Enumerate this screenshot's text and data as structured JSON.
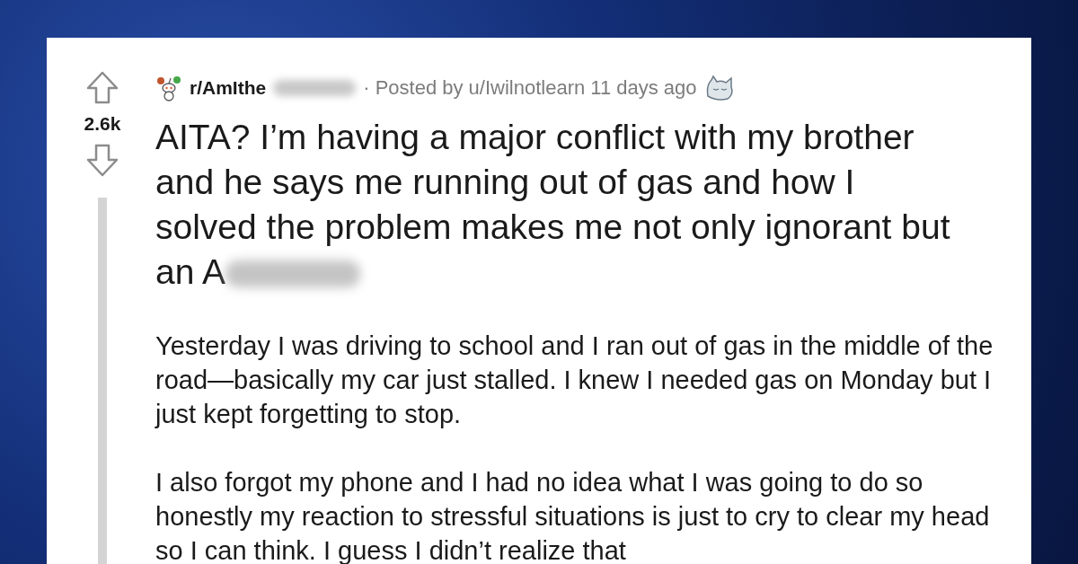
{
  "post": {
    "subreddit": "r/AmIthe",
    "posted_by": "· Posted by u/Iwilnotlearn 11 days ago",
    "votes": "2.6k",
    "title": "AITA? I’m having a major conflict with my brother and he says me running out of gas and how I solved the problem makes me not only ignorant but an A",
    "paragraphs": [
      "Yesterday I was driving to school and I ran out of gas in the middle of the road—basically my car just stalled. I knew I needed gas on Monday but I just kept forgetting to stop.",
      "I also forgot my phone and I had no idea what I was going to do so honestly my reaction to stressful situations is just to cry to clear my head so I can think. I guess I didn’t realize that"
    ]
  }
}
